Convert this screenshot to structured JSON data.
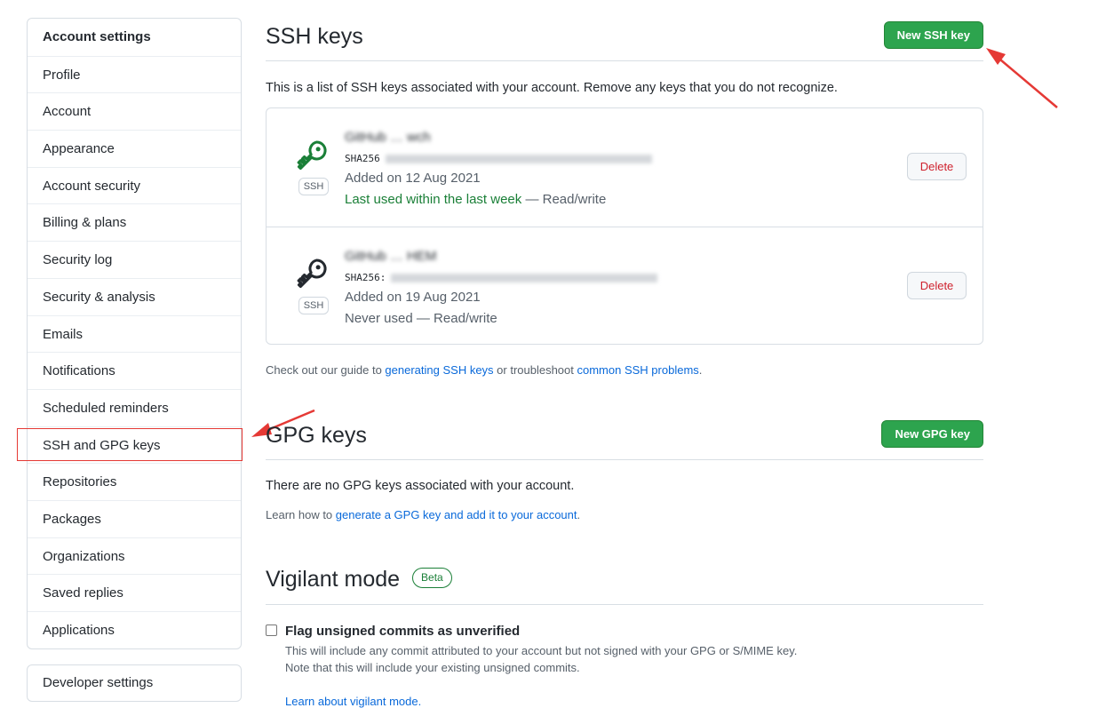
{
  "sidebar": {
    "heading": "Account settings",
    "items": [
      "Profile",
      "Account",
      "Appearance",
      "Account security",
      "Billing & plans",
      "Security log",
      "Security & analysis",
      "Emails",
      "Notifications",
      "Scheduled reminders",
      "SSH and GPG keys",
      "Repositories",
      "Packages",
      "Organizations",
      "Saved replies",
      "Applications"
    ],
    "active": "SSH and GPG keys",
    "developer": "Developer settings"
  },
  "ssh": {
    "title": "SSH keys",
    "new_button": "New SSH key",
    "description": "This is a list of SSH keys associated with your account. Remove any keys that you do not recognize.",
    "keys": [
      {
        "badge": "SSH",
        "title": "GitHub … wch",
        "fingerprint_prefix": "SHA256",
        "added": "Added on 12 Aug 2021",
        "last_used": "Last used within the last week",
        "access": "— Read/write",
        "delete_label": "Delete",
        "icon_color": "#1a7f37"
      },
      {
        "badge": "SSH",
        "title": "GitHub … HEM",
        "fingerprint_prefix": "SHA256:",
        "added": "Added on 19 Aug 2021",
        "last_used": "Never used",
        "access": "— Read/write",
        "delete_label": "Delete",
        "icon_color": "#24292f"
      }
    ],
    "guide_prefix": "Check out our guide to ",
    "guide_link1": "generating SSH keys",
    "guide_mid": " or troubleshoot ",
    "guide_link2": "common SSH problems",
    "guide_suffix": "."
  },
  "gpg": {
    "title": "GPG keys",
    "new_button": "New GPG key",
    "empty_text": "There are no GPG keys associated with your account.",
    "learn_prefix": "Learn how to ",
    "learn_link": "generate a GPG key and add it to your account",
    "learn_suffix": "."
  },
  "vigilant": {
    "title": "Vigilant mode",
    "badge": "Beta",
    "checkbox_label": "Flag unsigned commits as unverified",
    "note1": "This will include any commit attributed to your account but not signed with your GPG or S/MIME key.",
    "note2": "Note that this will include your existing unsigned commits.",
    "learn_link": "Learn about vigilant mode."
  },
  "colors": {
    "accent_green": "#2da44e",
    "link": "#0969da",
    "danger": "#cf222e",
    "annotation_red": "#e53935"
  }
}
